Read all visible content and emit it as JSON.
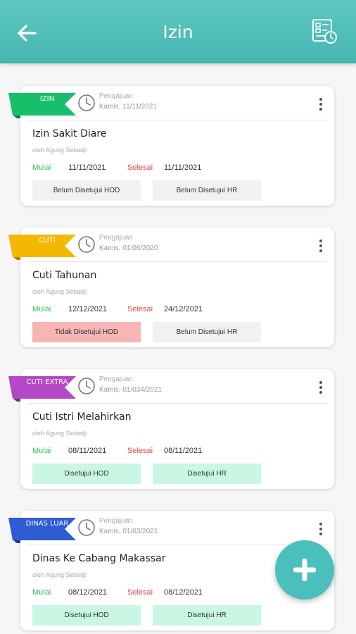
{
  "header": {
    "title": "Izin"
  },
  "colors": {
    "accent": "#4bbfbb",
    "start": "#2ebd57",
    "end": "#ee4444"
  },
  "cards": [
    {
      "tag": "IZIN",
      "tag_color": "#18bf6a",
      "tag_dark": "#0f7a43",
      "sub_label": "Pengajuan",
      "sub_date": "Kamis, 11/11/2021",
      "title": "Izin Sakit Diare",
      "author": "oleh Agung Setiadji",
      "start_label": "Mulai",
      "start_value": "11/11/2021",
      "end_label": "Selesai",
      "end_value": "11/11/2021",
      "status_hod": "Belum Disetujui HOD",
      "status_hod_state": "pending",
      "status_hr": "Belum Disetujui HR",
      "status_hr_state": "pending"
    },
    {
      "tag": "CUTI",
      "tag_color": "#f5b800",
      "tag_dark": "#b08400",
      "sub_label": "Pengajuan",
      "sub_date": "Kamis, 01/06/2020",
      "title": "Cuti Tahunan",
      "author": "oleh Agung Setiadji",
      "start_label": "Mulai",
      "start_value": "12/12/2021",
      "end_label": "Selesai",
      "end_value": "24/12/2021",
      "status_hod": "Tidak Disetujui HOD",
      "status_hod_state": "rejected",
      "status_hr": "Belum Disetujui HR",
      "status_hr_state": "pending"
    },
    {
      "tag": "CUTI EXTRA",
      "tag_color": "#b548c6",
      "tag_dark": "#7a2a88",
      "sub_label": "Pengajuan",
      "sub_date": "Kamis, 01/034/2021",
      "title": "Cuti Istri Melahirkan",
      "author": "oleh Agung Setiadji",
      "start_label": "Mulai",
      "start_value": "08/11/2021",
      "end_label": "Selesai",
      "end_value": "08/11/2021",
      "status_hod": "Disetujui HOD",
      "status_hod_state": "approved",
      "status_hr": "Disetujui HR",
      "status_hr_state": "approved"
    },
    {
      "tag": "DINAS LUAR",
      "tag_color": "#2f5bd3",
      "tag_dark": "#1c3a8a",
      "sub_label": "Pengajuan",
      "sub_date": "Kamis, 01/03/2021",
      "title": "Dinas Ke Cabang Makassar",
      "author": "oleh Agung Setiadji",
      "start_label": "Mulai",
      "start_value": "08/12/2021",
      "end_label": "Selesai",
      "end_value": "08/12/2021",
      "status_hod": "Disetujui HOD",
      "status_hod_state": "approved",
      "status_hr": "Disetujui HR",
      "status_hr_state": "approved"
    }
  ],
  "icons": {
    "back": "arrow-left-icon",
    "report": "report-icon",
    "clock": "clock-icon",
    "more": "more-vertical-icon",
    "add": "plus-icon"
  }
}
